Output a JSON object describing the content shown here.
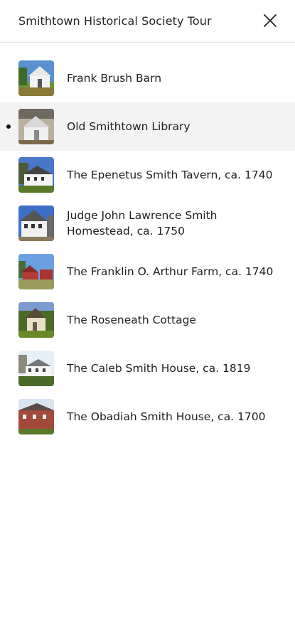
{
  "header": {
    "title": "Smithtown Historical Society Tour",
    "close_icon": "close-icon"
  },
  "stops": [
    {
      "label": "Frank Brush Barn",
      "active": false
    },
    {
      "label": "Old Smithtown Library",
      "active": true
    },
    {
      "label": "The Epenetus Smith Tavern, ca. 1740",
      "active": false
    },
    {
      "label": "Judge John Lawrence Smith Homestead, ca. 1750",
      "active": false
    },
    {
      "label": "The Franklin O. Arthur Farm, ca. 1740",
      "active": false
    },
    {
      "label": "The Roseneath Cottage",
      "active": false
    },
    {
      "label": "The Caleb Smith House, ca. 1819",
      "active": false
    },
    {
      "label": "The Obadiah Smith House, ca. 1700",
      "active": false
    }
  ]
}
